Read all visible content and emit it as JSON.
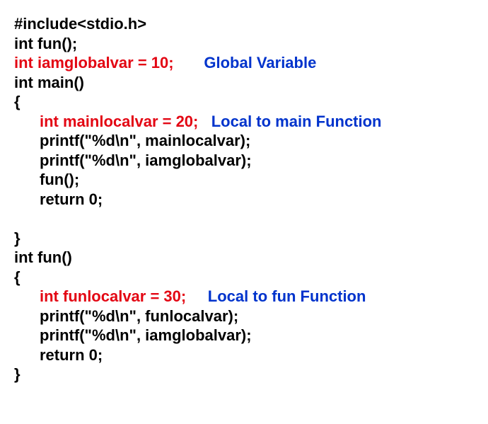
{
  "code": {
    "l1": "#include<stdio.h>",
    "l2": "int fun();",
    "l3_red": "int iamglobalvar = 10;",
    "l3_blue": "Global Variable",
    "l4": "int main()",
    "l5": "{",
    "l6_red": "int mainlocalvar = 20;",
    "l6_blue": "Local to main Function",
    "l7": "printf(\"%d\\n\", mainlocalvar);",
    "l8": "printf(\"%d\\n\", iamglobalvar);",
    "l9": "fun();",
    "l10": "return 0;",
    "blank": " ",
    "l11": "}",
    "l12": "int fun()",
    "l13": "{",
    "l14_red": "int funlocalvar = 30;",
    "l14_blue": "Local to fun Function",
    "l15": "printf(\"%d\\n\", funlocalvar);",
    "l16": "printf(\"%d\\n\", iamglobalvar);",
    "l17": "return 0;",
    "l18": "}"
  }
}
